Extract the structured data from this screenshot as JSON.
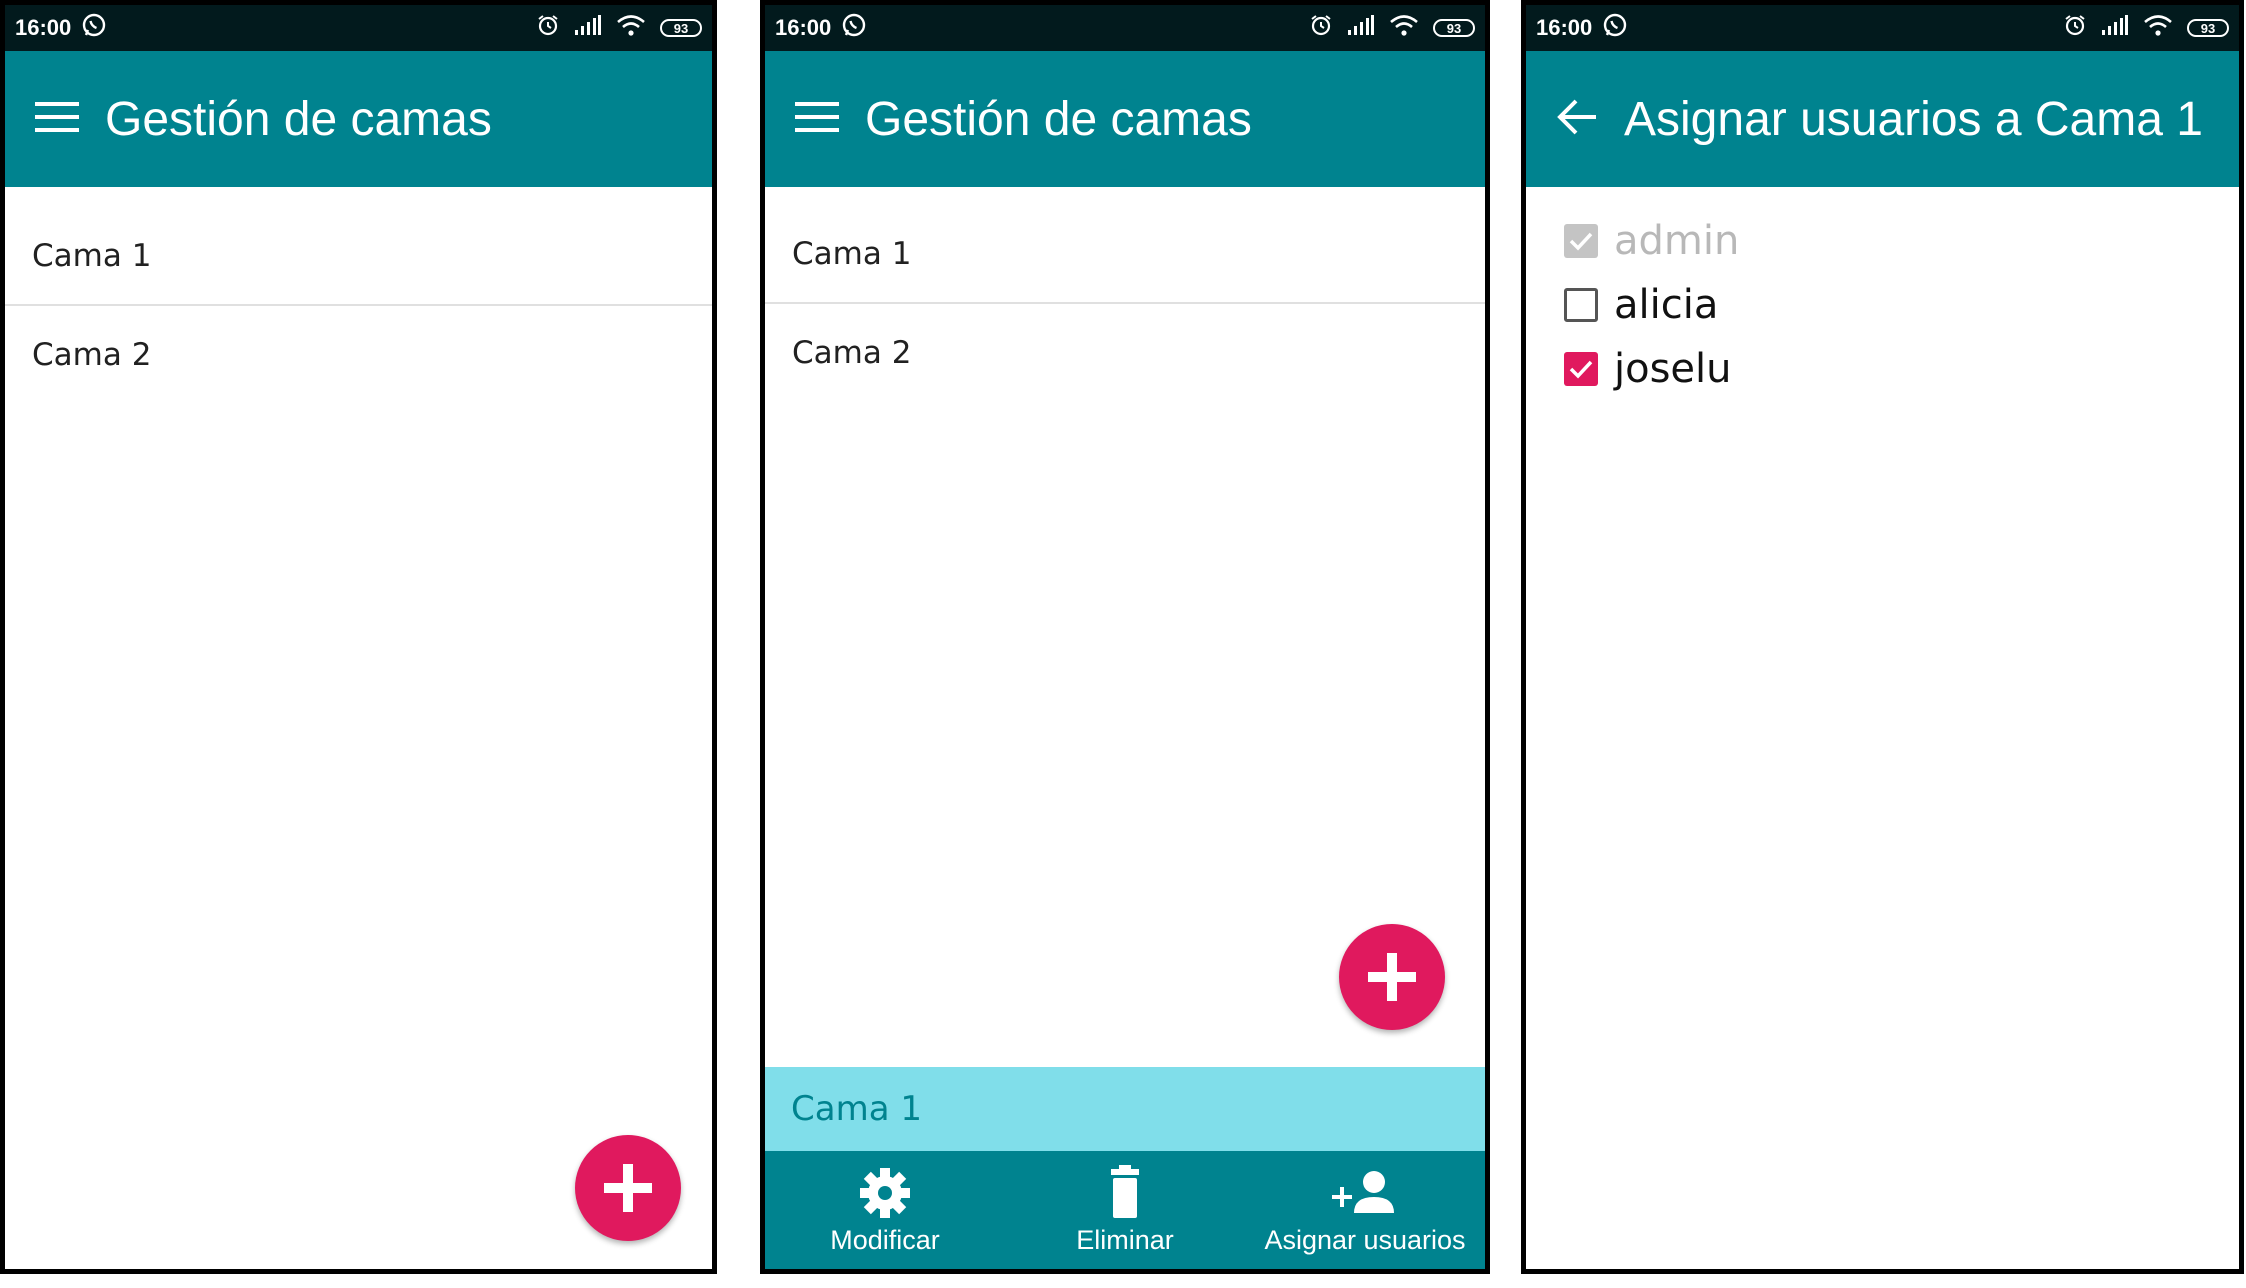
{
  "status_bar": {
    "time": "16:00",
    "battery": "93"
  },
  "screen1": {
    "title": "Gestión de camas",
    "items": [
      "Cama 1",
      "Cama 2"
    ]
  },
  "screen2": {
    "title": "Gestión de camas",
    "items": [
      "Cama 1",
      "Cama 2"
    ],
    "selected": "Cama 1",
    "actions": {
      "modify": "Modificar",
      "delete": "Eliminar",
      "assign": "Asignar usuarios"
    }
  },
  "screen3": {
    "title": "Asignar usuarios a Cama 1",
    "users": [
      {
        "name": "admin",
        "checked": true,
        "enabled": false
      },
      {
        "name": "alicia",
        "checked": false,
        "enabled": true
      },
      {
        "name": "joselu",
        "checked": true,
        "enabled": true
      }
    ]
  },
  "colors": {
    "primary": "#00838f",
    "accent": "#e0195e",
    "selection": "#80deea",
    "status_bar": "#021a1d"
  },
  "icons": [
    "menu-icon",
    "back-arrow-icon",
    "add-icon",
    "gear-icon",
    "trash-icon",
    "add-user-icon",
    "whatsapp-icon",
    "alarm-icon",
    "signal-icon",
    "wifi-icon",
    "battery-icon"
  ]
}
